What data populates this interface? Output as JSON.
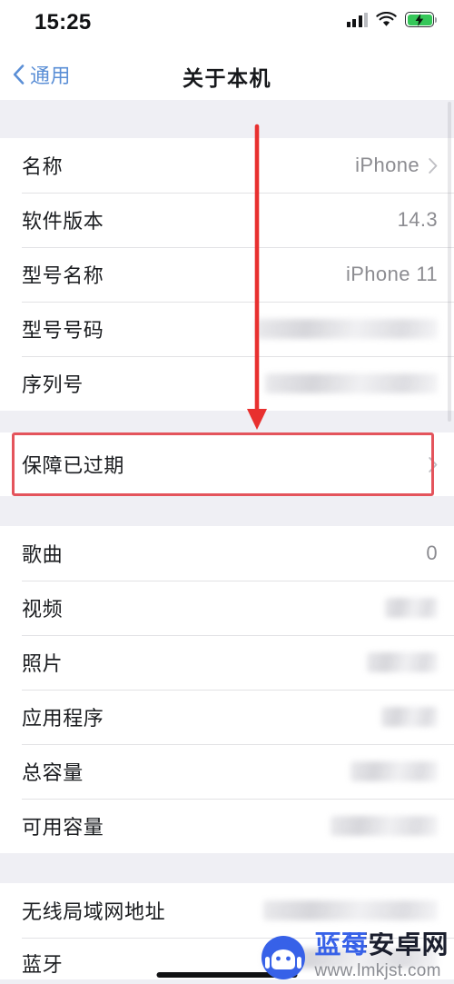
{
  "status_bar": {
    "time": "15:25",
    "signal_icon": "cellular-signal-icon",
    "wifi_icon": "wifi-icon",
    "battery_icon": "battery-charging-icon",
    "battery_color": "#35c759"
  },
  "nav_bar": {
    "back_label": "通用",
    "back_icon": "chevron-left-icon",
    "title": "关于本机",
    "accent_color": "#5b8fd6"
  },
  "sections": [
    {
      "id": "device-info",
      "rows": [
        {
          "label": "名称",
          "value": "iPhone",
          "redacted": false,
          "chevron": true
        },
        {
          "label": "软件版本",
          "value": "14.3",
          "redacted": false,
          "chevron": false
        },
        {
          "label": "型号名称",
          "value": "iPhone 11",
          "redacted": false,
          "chevron": false
        },
        {
          "label": "型号号码",
          "value": "",
          "redacted": true,
          "redacted_width": 200,
          "chevron": false
        },
        {
          "label": "序列号",
          "value": "",
          "redacted": true,
          "redacted_width": 190,
          "chevron": false
        }
      ]
    },
    {
      "id": "coverage",
      "highlighted": true,
      "highlight_color": "#e4545c",
      "rows": [
        {
          "label": "保障已过期",
          "value": "",
          "redacted": false,
          "chevron": true
        }
      ]
    },
    {
      "id": "storage-media",
      "rows": [
        {
          "label": "歌曲",
          "value": "0",
          "redacted": false,
          "chevron": false
        },
        {
          "label": "视频",
          "value": "",
          "redacted": true,
          "redacted_width": 58,
          "chevron": false
        },
        {
          "label": "照片",
          "value": "",
          "redacted": true,
          "redacted_width": 78,
          "chevron": false
        },
        {
          "label": "应用程序",
          "value": "",
          "redacted": true,
          "redacted_width": 62,
          "chevron": false
        },
        {
          "label": "总容量",
          "value": "",
          "redacted": true,
          "redacted_width": 96,
          "chevron": false
        },
        {
          "label": "可用容量",
          "value": "",
          "redacted": true,
          "redacted_width": 118,
          "chevron": false
        }
      ]
    },
    {
      "id": "network",
      "rows": [
        {
          "label": "无线局域网地址",
          "value": "",
          "redacted": true,
          "redacted_width": 192,
          "chevron": false
        },
        {
          "label": "蓝牙",
          "value": "",
          "redacted": true,
          "redacted_width": 192,
          "chevron": false
        }
      ]
    }
  ],
  "annotation": {
    "arrow_color": "#e8302f",
    "arrow_label": "arrow pointing to 保障已过期 row",
    "box_color": "#e4545c"
  },
  "watermark": {
    "site_name": "蓝莓安卓网",
    "url": "www.lmkjst.com",
    "logo_icon": "blueberry-android-logo-icon",
    "brand_color": "#3761e8"
  }
}
